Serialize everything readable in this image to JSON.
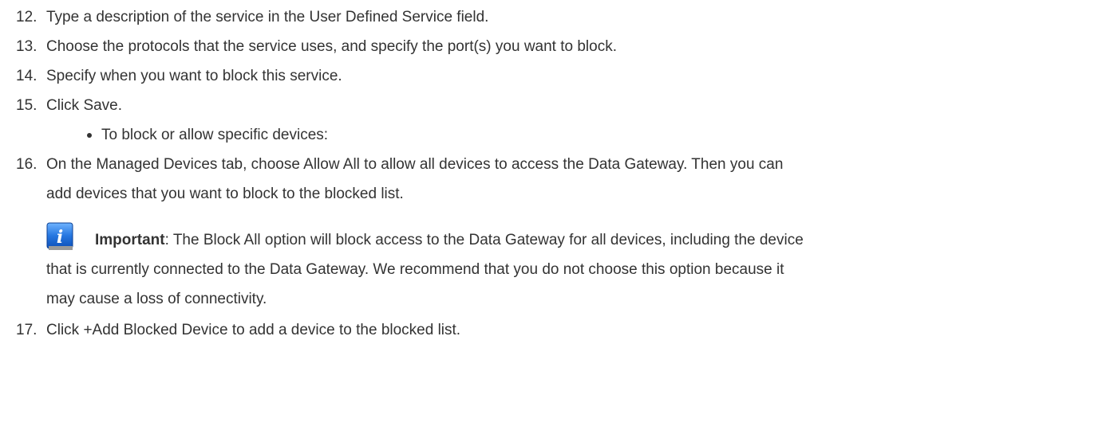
{
  "steps": [
    {
      "number": "12.",
      "text": "Type a description of the service in the User Defined Service field."
    },
    {
      "number": "13.",
      "text": "Choose the protocols that the service uses, and specify the port(s) you want to block."
    },
    {
      "number": "14.",
      "text": "Specify when you want to block this service."
    },
    {
      "number": "15.",
      "text": "Click Save."
    },
    {
      "number": "16.",
      "text_line1": "On the Managed Devices tab, choose Allow All to allow all devices to access the Data Gateway. Then you can",
      "text_line2": "add devices that you want to block to the blocked list."
    },
    {
      "number": "17.",
      "text": "Click +Add Blocked Device to add a device to the blocked list."
    }
  ],
  "bullet": "To block or allow specific devices:",
  "note": {
    "icon": "info-icon",
    "label": "Important",
    "line1_rest": ": The Block All option will block access to the Data Gateway for all devices, including the device",
    "line2": "that is currently connected to the Data Gateway. We recommend that you do not choose this option because it",
    "line3": "may cause a loss of connectivity."
  }
}
